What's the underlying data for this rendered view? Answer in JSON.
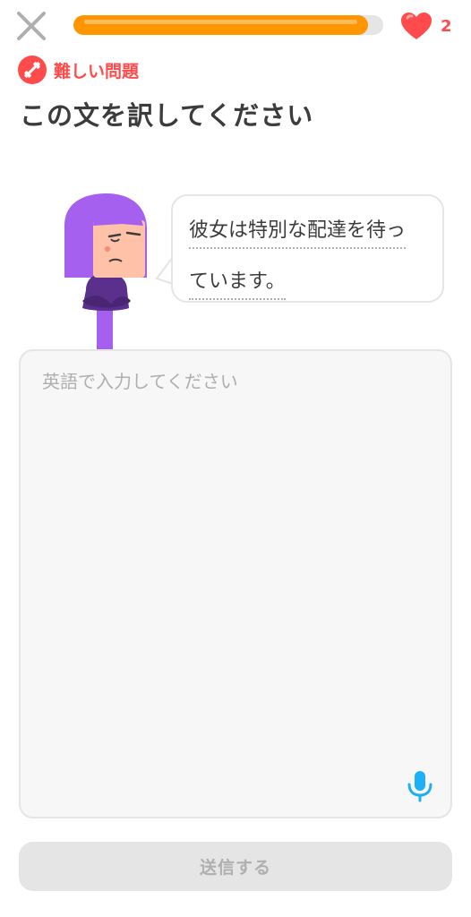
{
  "header": {
    "progress_percent": 95,
    "hearts_count": "2"
  },
  "challenge": {
    "badge_label": "難しい問題",
    "title": "この文を訳してください",
    "prompt_line1": "彼女は特別な配達を待っ",
    "prompt_line2": "ています。"
  },
  "answer": {
    "placeholder": "英語で入力してください",
    "value": ""
  },
  "footer": {
    "submit_label": "送信する"
  },
  "colors": {
    "progress": "#ff9600",
    "heart": "#ff4b4b",
    "mic": "#1cb0f6",
    "character_hair": "#a560f0",
    "character_body": "#5b2f8c"
  },
  "icons": [
    "close-icon",
    "heart-icon",
    "dumbbell-icon",
    "microphone-icon"
  ]
}
